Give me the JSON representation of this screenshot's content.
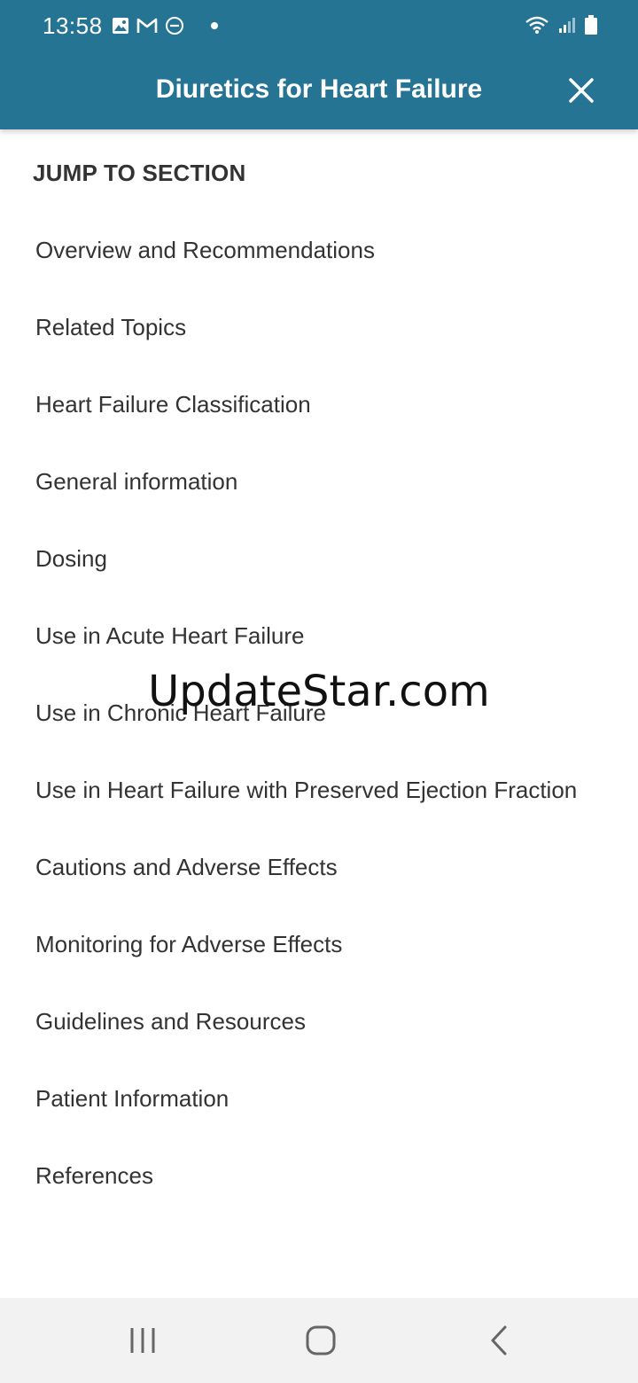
{
  "status_bar": {
    "time": "13:58",
    "left_icons": [
      "image-icon",
      "gmail-icon",
      "do-not-disturb-icon",
      "notification-dot-icon"
    ],
    "right_icons": [
      "wifi-icon",
      "signal-icon",
      "battery-icon"
    ]
  },
  "header": {
    "title": "Diuretics for Heart Failure",
    "close_icon": "close-icon"
  },
  "section_heading": "JUMP TO SECTION",
  "sections": [
    "Overview and Recommendations",
    "Related Topics",
    "Heart Failure Classification",
    "General information",
    "Dosing",
    "Use in Acute Heart Failure",
    "Use in Chronic Heart Failure",
    "Use in Heart Failure with Preserved Ejection Fraction",
    "Cautions and Adverse Effects",
    "Monitoring for Adverse Effects",
    "Guidelines and Resources",
    "Patient Information",
    "References"
  ],
  "watermark": "UpdateStar.com",
  "nav_bar": [
    "recents-icon",
    "home-icon",
    "back-icon"
  ],
  "colors": {
    "header_bg": "#257494",
    "text": "#333333",
    "nav_bg": "#f2f2f2"
  }
}
